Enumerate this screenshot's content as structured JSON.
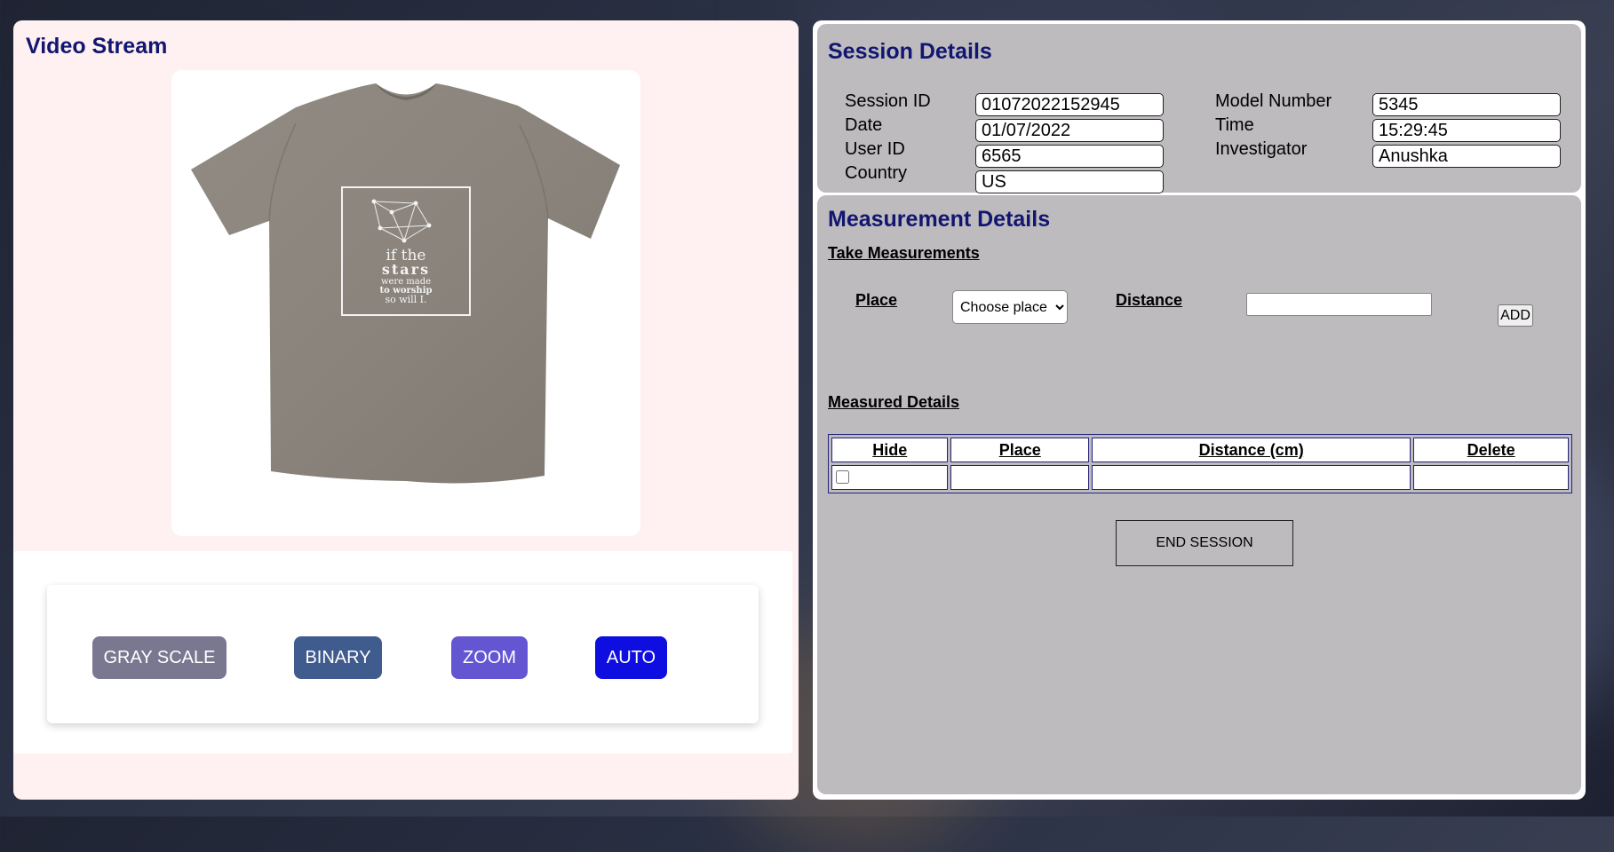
{
  "video": {
    "title": "Video Stream",
    "shirt_print": [
      "if the",
      "stars",
      "were made",
      "to worship",
      "so will I."
    ],
    "controls": [
      "GRAY SCALE",
      "BINARY",
      "ZOOM",
      "AUTO"
    ],
    "control_colors": [
      "#7a7891",
      "#405b8e",
      "#6455d2",
      "#0f0ee1"
    ]
  },
  "session": {
    "title": "Session Details",
    "fields": {
      "session_id": {
        "label": "Session ID",
        "value": "01072022152945"
      },
      "date": {
        "label": "Date",
        "value": "01/07/2022"
      },
      "user_id": {
        "label": "User ID",
        "value": "6565"
      },
      "country": {
        "label": "Country",
        "value": "US"
      },
      "model_number": {
        "label": "Model Number",
        "value": "5345"
      },
      "time": {
        "label": "Time",
        "value": "15:29:45"
      },
      "investigator": {
        "label": "Investigator",
        "value": "Anushka"
      }
    }
  },
  "measurement": {
    "title": "Measurement Details",
    "take_heading": "Take Measurements",
    "place_label": "Place",
    "place_selected": "Choose place",
    "distance_label": "Distance",
    "distance_value": "",
    "add_label": "ADD",
    "measured_heading": "Measured Details",
    "table_headers": [
      "Hide",
      "Place",
      "Distance (cm)",
      "Delete"
    ],
    "end_session_label": "END SESSION"
  },
  "colors": {
    "heading": "#121670",
    "panel_gray": "#bdbbbd",
    "left_bg": "#fff1f1"
  }
}
